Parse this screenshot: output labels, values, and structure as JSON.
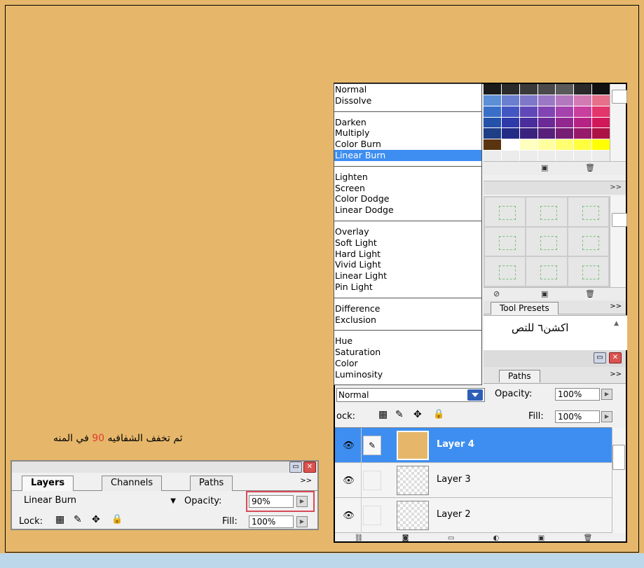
{
  "caption": {
    "before": "ثم تخفف الشفافيه",
    "highlight": "90",
    "after": "في المنه"
  },
  "blend_menu": {
    "groups": [
      [
        "Normal",
        "Dissolve"
      ],
      [
        "Darken",
        "Multiply",
        "Color Burn",
        "Linear Burn"
      ],
      [
        "Lighten",
        "Screen",
        "Color Dodge",
        "Linear Dodge"
      ],
      [
        "Overlay",
        "Soft Light",
        "Hard Light",
        "Vivid Light",
        "Linear Light",
        "Pin Light"
      ],
      [
        "Difference",
        "Exclusion"
      ],
      [
        "Hue",
        "Saturation",
        "Color",
        "Luminosity"
      ]
    ],
    "selected": "Linear Burn"
  },
  "right_panel": {
    "tool_presets_tab": "Tool Presets",
    "action_text": "اكشن٦ للتص",
    "paths_tab": "Paths",
    "more_glyph": ">>",
    "mode_value": "Normal",
    "opacity_label": "Opacity:",
    "opacity_value": "100%",
    "lock_label": "ock:",
    "fill_label": "Fill:",
    "fill_value": "100%",
    "layers": [
      {
        "name": "Layer 4",
        "selected": true
      },
      {
        "name": "Layer 3",
        "selected": false
      },
      {
        "name": "Layer 2",
        "selected": false
      }
    ]
  },
  "left_panel": {
    "tabs": [
      "Layers",
      "Channels",
      "Paths"
    ],
    "more_glyph": ">>",
    "mode_value": "Linear Burn",
    "opacity_label": "Opacity:",
    "opacity_value": "90%",
    "lock_label": "Lock:",
    "fill_label": "Fill:",
    "fill_value": "100%"
  },
  "swatch_colors": [
    "#1b1b1b",
    "#2b2b2b",
    "#3a3a3a",
    "#4a4a4a",
    "#5a5a5a",
    "#2a2a2a",
    "#111111",
    "#5b8fd6",
    "#6a7fd0",
    "#7f78c8",
    "#9a78c4",
    "#b478bf",
    "#d27ab4",
    "#e66f8a",
    "#3a6fc9",
    "#4456c4",
    "#6048b8",
    "#8144b2",
    "#a542ad",
    "#c93f9e",
    "#e3346b",
    "#2452a8",
    "#2e3aa8",
    "#4a2e9c",
    "#6c2a96",
    "#902890",
    "#b52484",
    "#d1195a",
    "#1e3f86",
    "#222c86",
    "#3a227d",
    "#58207a",
    "#761e74",
    "#961a69",
    "#ad1244",
    "#5a3410",
    "#ffffff",
    "#ffffc0",
    "#ffffa0",
    "#ffff70",
    "#ffff40",
    "#ffff00",
    "#ececec",
    "#ececec",
    "#ececec",
    "#ececec",
    "#ececec",
    "#ececec",
    "#ececec"
  ]
}
